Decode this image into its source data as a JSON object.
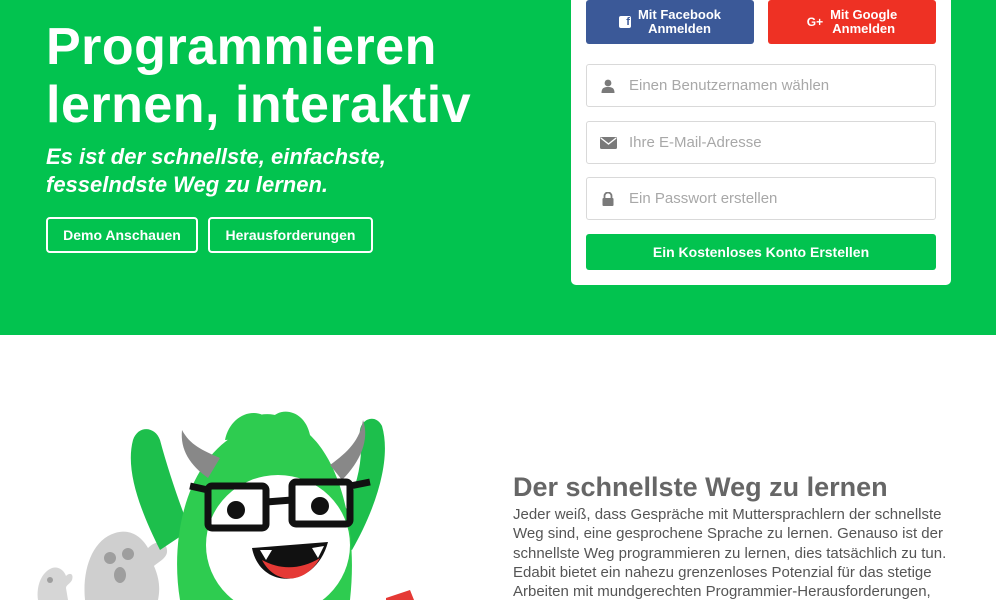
{
  "hero": {
    "title_line1": "Programmieren",
    "title_line2": "lernen, interaktiv",
    "subtitle_line1": "Es ist der schnellste, einfachste,",
    "subtitle_line2": "fesselndste Weg zu lernen.",
    "demo_button": "Demo Anschauen",
    "challenges_button": "Herausforderungen",
    "background_color": "#02c34f"
  },
  "signup": {
    "facebook_line1": "Mit Facebook",
    "facebook_line2": "Anmelden",
    "google_line1": "Mit Google",
    "google_line2": "Anmelden",
    "google_icon_text": "G+",
    "username_placeholder": "Einen Benutzernamen wählen",
    "email_placeholder": "Ihre E-Mail-Adresse",
    "password_placeholder": "Ein Passwort erstellen",
    "create_button": "Ein Kostenloses Konto Erstellen",
    "facebook_color": "#3b5998",
    "google_color": "#ee3124"
  },
  "icons": {
    "facebook": "facebook-icon",
    "google": "google-plus-icon",
    "user": "user-icon",
    "email": "envelope-icon",
    "password": "lock-icon"
  },
  "section": {
    "title": "Der schnellste Weg zu lernen",
    "body": "Jeder weiß, dass Gespräche mit Muttersprachlern der schnellste Weg sind, eine gesprochene Sprache zu lernen. Genauso ist der schnellste Weg programmieren zu lernen, dies tatsächlich zu tun. Edabit bietet ein nahezu grenzenloses Potenzial für das stetige Arbeiten mit mundgerechten Programmier-Herausforderungen,"
  }
}
